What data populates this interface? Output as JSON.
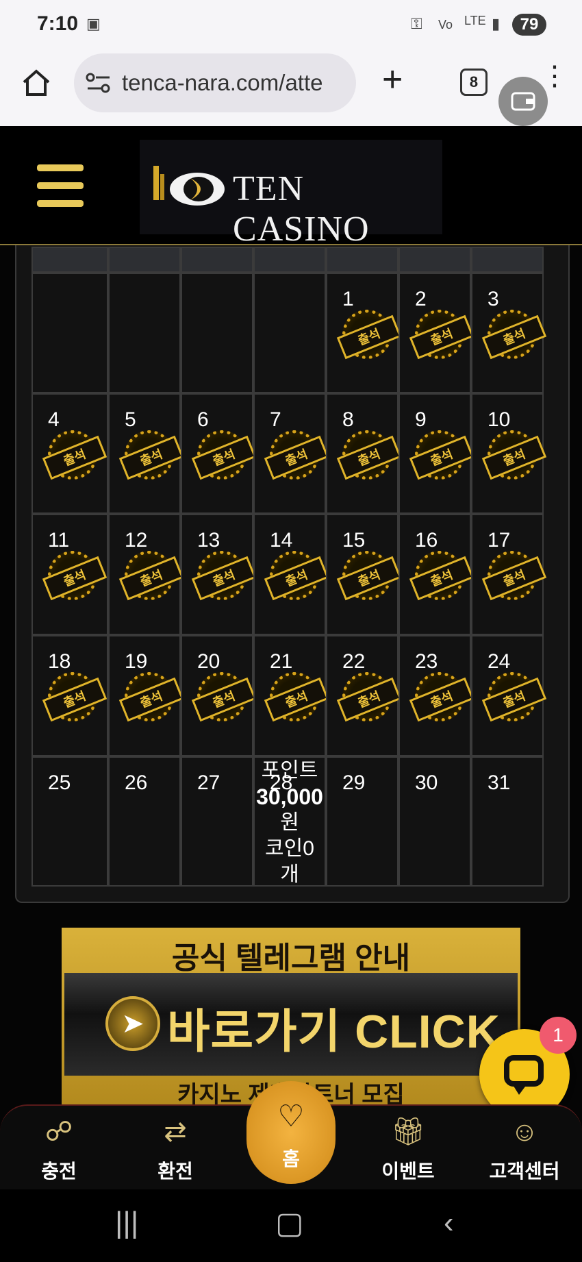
{
  "status_bar": {
    "time": "7:10",
    "network": "LTE",
    "battery": "79"
  },
  "browser": {
    "url": "tenca-nara.com/atte",
    "tab_count": "8"
  },
  "site": {
    "logo_text": "TEN CASINO"
  },
  "calendar": {
    "stamp_text": "출석",
    "weeks": [
      [
        {
          "d": ""
        },
        {
          "d": ""
        },
        {
          "d": ""
        },
        {
          "d": ""
        },
        {
          "d": "1",
          "s": true
        },
        {
          "d": "2",
          "s": true
        },
        {
          "d": "3",
          "s": true
        }
      ],
      [
        {
          "d": "4",
          "s": true
        },
        {
          "d": "5",
          "s": true
        },
        {
          "d": "6",
          "s": true
        },
        {
          "d": "7",
          "s": true
        },
        {
          "d": "8",
          "s": true
        },
        {
          "d": "9",
          "s": true
        },
        {
          "d": "10",
          "s": true
        }
      ],
      [
        {
          "d": "11",
          "s": true
        },
        {
          "d": "12",
          "s": true
        },
        {
          "d": "13",
          "s": true
        },
        {
          "d": "14",
          "s": true
        },
        {
          "d": "15",
          "s": true
        },
        {
          "d": "16",
          "s": true
        },
        {
          "d": "17",
          "s": true
        }
      ],
      [
        {
          "d": "18",
          "s": true
        },
        {
          "d": "19",
          "s": true
        },
        {
          "d": "20",
          "s": true
        },
        {
          "d": "21",
          "s": true
        },
        {
          "d": "22",
          "s": true
        },
        {
          "d": "23",
          "s": true
        },
        {
          "d": "24",
          "s": true
        }
      ],
      [
        {
          "d": "25"
        },
        {
          "d": "26"
        },
        {
          "d": "27"
        },
        {
          "d": "28"
        },
        {
          "d": "29"
        },
        {
          "d": "30"
        },
        {
          "d": "31"
        }
      ]
    ],
    "point_info": {
      "label": "포인트",
      "amount": "30,000",
      "unit": "원",
      "coin": "코인0",
      "coin_unit": "개"
    }
  },
  "banner": {
    "title": "공식 텔레그램 안내",
    "click": "바로가기 CLICK",
    "footer": "카지노 제휴파트너 모집"
  },
  "chat": {
    "badge": "1"
  },
  "nav": {
    "charge": "충전",
    "exchange": "환전",
    "home": "홈",
    "event": "이벤트",
    "support": "고객센터"
  }
}
